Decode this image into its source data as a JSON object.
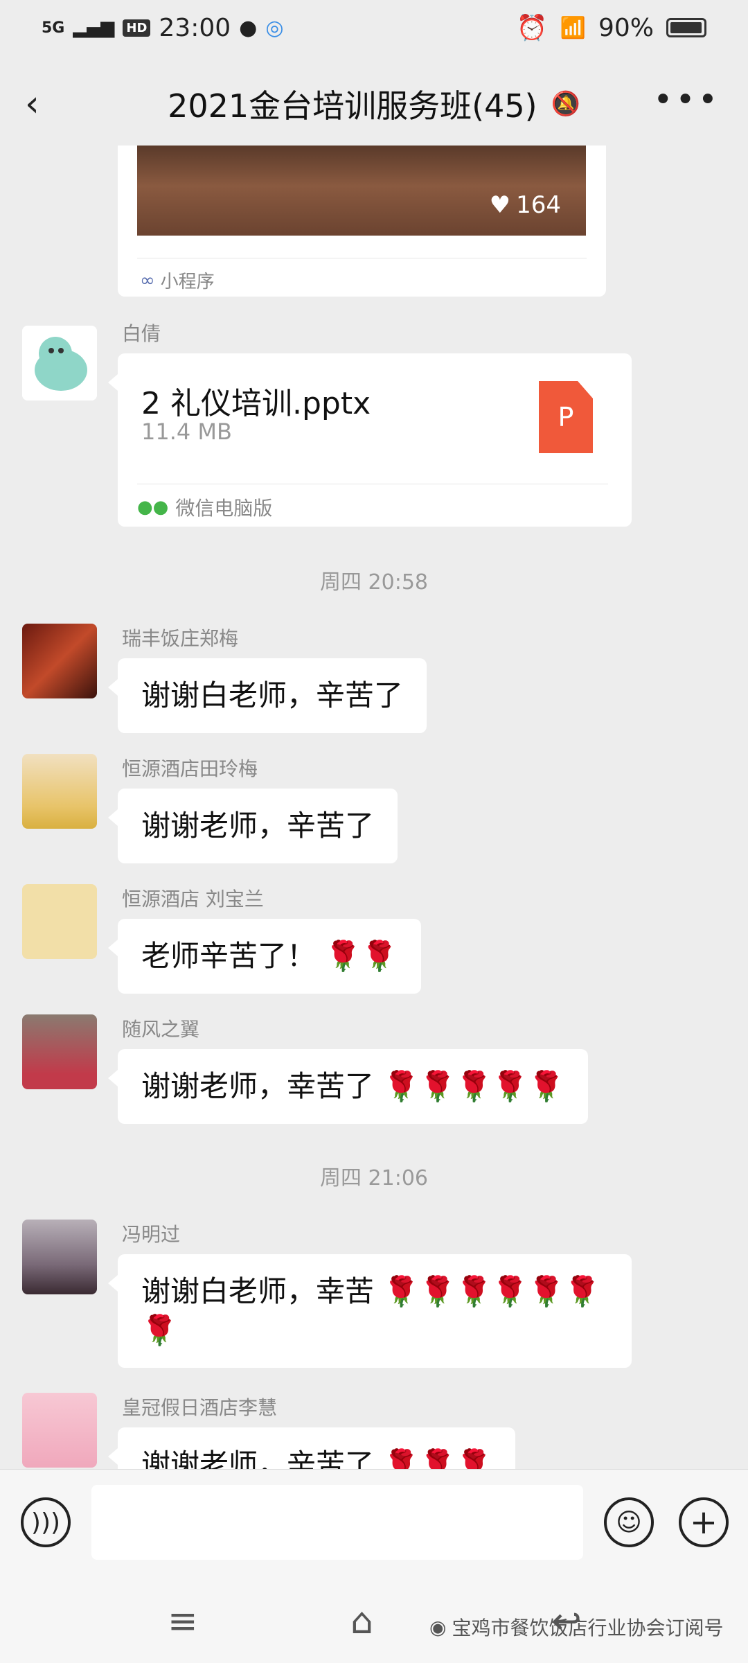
{
  "status_bar": {
    "network": "5G",
    "hd": "HD",
    "time": "23:00",
    "battery": "90%"
  },
  "header": {
    "title": "2021金台培训服务班(45)"
  },
  "mini_program_card": {
    "likes": "164",
    "label": "小程序"
  },
  "messages": {
    "file": {
      "sender": "白倩",
      "file_name": "2 礼仪培训.pptx",
      "file_size": "11.4 MB",
      "file_icon_letter": "P",
      "source": "微信电脑版"
    },
    "time1": "周四 20:58",
    "m1": {
      "sender": "瑞丰饭庄郑梅",
      "text": "谢谢白老师，辛苦了"
    },
    "m2": {
      "sender": "恒源酒店田玲梅",
      "text": "谢谢老师，辛苦了"
    },
    "m3": {
      "sender": "恒源酒店 刘宝兰",
      "text": "老师辛苦了！",
      "roses": "🌹🌹"
    },
    "m4": {
      "sender": "随风之翼",
      "text": "谢谢老师，幸苦了",
      "roses": "🌹🌹🌹🌹🌹"
    },
    "time2": "周四 21:06",
    "m5": {
      "sender": "冯明过",
      "text": "谢谢白老师，幸苦",
      "roses": "🌹🌹🌹🌹🌹🌹🌹"
    },
    "m6": {
      "sender": "皇冠假日酒店李慧",
      "text": "谢谢老师，辛苦了",
      "roses": "🌹🌹🌹"
    }
  },
  "navbar": {
    "watermark": "宝鸡市餐饮饭店行业协会订阅号"
  }
}
